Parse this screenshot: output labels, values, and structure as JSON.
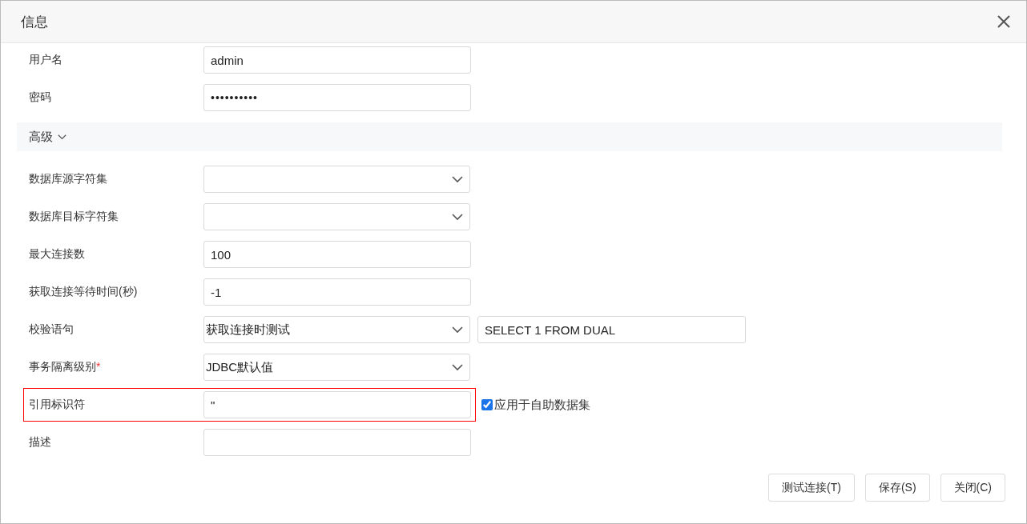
{
  "dialog": {
    "title": "信息"
  },
  "rows": [
    {
      "kind": "input",
      "label": "用户名",
      "value": "admin"
    },
    {
      "kind": "password",
      "label": "密码",
      "value": "••••••••••"
    },
    {
      "kind": "section",
      "label": "高级",
      "expanded": true
    },
    {
      "kind": "select",
      "label": "数据库源字符集"
    },
    {
      "kind": "select",
      "label": "数据库目标字符集"
    },
    {
      "kind": "input",
      "label": "最大连接数",
      "value": "100"
    },
    {
      "kind": "input",
      "label": "获取连接等待时间(秒)",
      "value": "-1"
    },
    {
      "kind": "select",
      "label": "校验语句",
      "value": "获取连接时测试",
      "extra_field": "SELECT 1 FROM DUAL"
    },
    {
      "kind": "select",
      "label": "事务隔离级别",
      "value": "JDBC默认值",
      "required_mark": "*"
    },
    {
      "kind": "input",
      "label": "引用标识符",
      "value": "\"",
      "highlighted": true,
      "checkbox": {
        "label": "应用于自助数据集",
        "checked": true
      }
    },
    {
      "kind": "input",
      "label": "描述"
    }
  ],
  "buttons": [
    "测试连接(T)",
    "保存(S)",
    "关闭(C)"
  ]
}
